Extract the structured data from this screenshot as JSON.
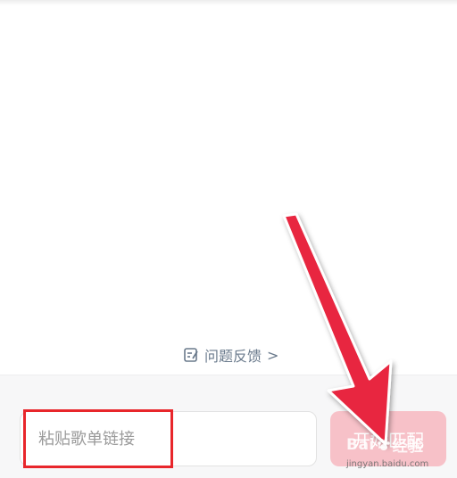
{
  "feedback": {
    "label": "问题反馈",
    "chevron": ">",
    "icon": "edit-note-icon"
  },
  "input": {
    "placeholder": "粘贴歌单链接",
    "value": ""
  },
  "button": {
    "label": "开始匹配"
  },
  "annotation": {
    "box_color": "#e8262b",
    "arrow_color": "#e8263f"
  },
  "watermark": {
    "brand": "Bai",
    "brand_tail": "经验",
    "url": "jingyan.baidu.com"
  },
  "colors": {
    "button_bg": "#f7c1c8",
    "feedback_text": "#6a7a8c"
  }
}
